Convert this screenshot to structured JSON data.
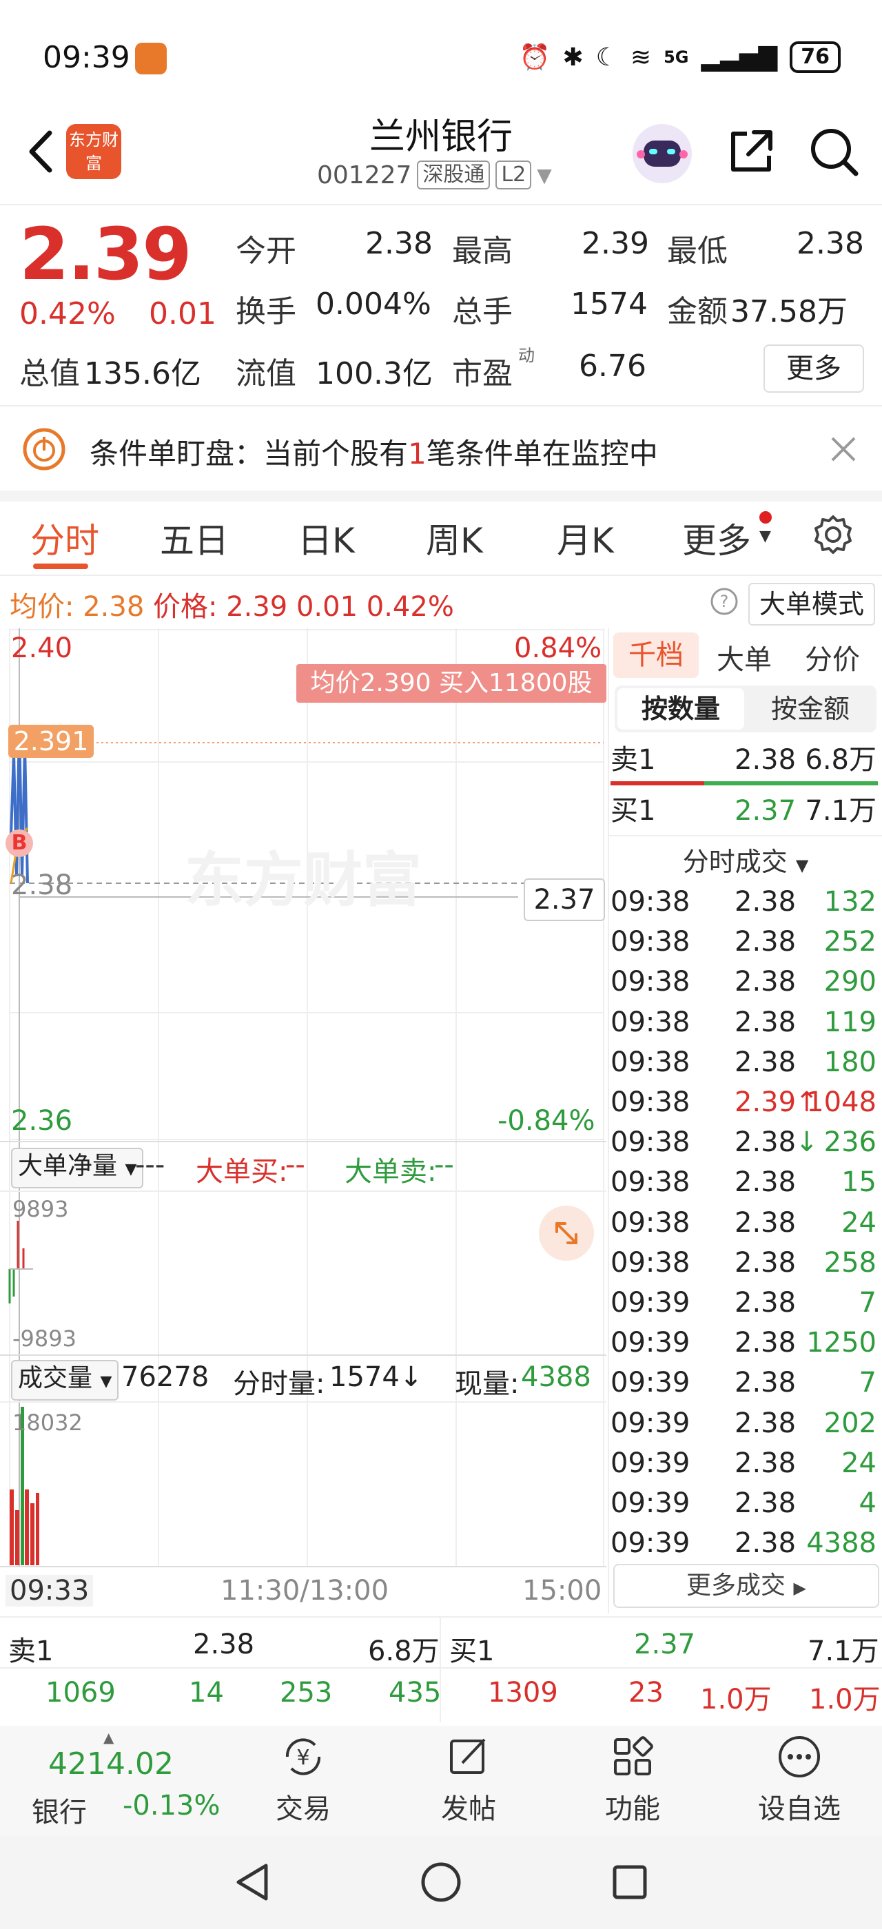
{
  "status_bar": {
    "time": "09:39",
    "network": "5G",
    "battery": "76"
  },
  "header": {
    "logo_text": "东方财富",
    "stock_name": "兰州银行",
    "stock_code": "001227",
    "tag_connect": "深股通",
    "tag_level": "L2"
  },
  "quote": {
    "price": "2.39",
    "pct_change": "0.42%",
    "abs_change": "0.01",
    "open_label": "今开",
    "open": "2.38",
    "high_label": "最高",
    "high": "2.39",
    "low_label": "最低",
    "low": "2.38",
    "turnover_label": "换手",
    "turnover": "0.004%",
    "volume_label": "总手",
    "volume": "1574",
    "amount_label": "金额",
    "amount": "37.58万",
    "mktcap_label": "总值",
    "mktcap": "135.6亿",
    "float_label": "流值",
    "float_cap": "100.3亿",
    "pe_label": "市盈",
    "pe_sup": "动",
    "pe": "6.76",
    "more_label": "更多"
  },
  "condition_banner": {
    "text_pre": "条件单盯盘：当前个股有",
    "count": "1",
    "text_post": "笔条件单在监控中"
  },
  "tabs": [
    "分时",
    "五日",
    "日K",
    "周K",
    "月K",
    "更多"
  ],
  "avg_row": {
    "avg_label": "均价:",
    "avg": "2.38",
    "price_label": "价格:",
    "price": "2.39",
    "change": "0.01",
    "pct": "0.42%",
    "mode_label": "大单模式"
  },
  "chart": {
    "y_top": "2.40",
    "y_top_pct": "0.84%",
    "y_mid": "2.38",
    "y_bottom": "2.36",
    "y_bottom_pct": "-0.84%",
    "price_tag": "2.391",
    "trade_bubble": "均价2.390  买入11800股",
    "cross_price": "2.37",
    "b_marker": "B",
    "watermark": "东方财富",
    "net_selector": "大单净量",
    "net_dashes": "---",
    "big_buy_label": "大单买:",
    "big_buy": "--",
    "big_sell_label": "大单卖:",
    "big_sell": "--",
    "net_max": "9893",
    "net_min": "-9893",
    "vol_selector": "成交量",
    "vol_total": "76278",
    "vol_minute_label": "分时量:",
    "vol_minute": "1574↓",
    "vol_current_label": "现量:",
    "vol_current": "4388",
    "vol_max": "18032",
    "time_start": "09:33",
    "time_mid": "11:30/13:00",
    "time_end": "15:00"
  },
  "right_panel": {
    "tabs": [
      "千档",
      "大单",
      "分价"
    ],
    "seg_qty": "按数量",
    "seg_amt": "按金额",
    "sell1": {
      "label": "卖1",
      "price": "2.38",
      "qty": "6.8万"
    },
    "buy1": {
      "label": "买1",
      "price": "2.37",
      "qty": "7.1万"
    },
    "ticks_title": "分时成交",
    "ticks": [
      {
        "time": "09:38",
        "price": "2.38",
        "vol": "132",
        "dir": ""
      },
      {
        "time": "09:38",
        "price": "2.38",
        "vol": "252",
        "dir": ""
      },
      {
        "time": "09:38",
        "price": "2.38",
        "vol": "290",
        "dir": ""
      },
      {
        "time": "09:38",
        "price": "2.38",
        "vol": "119",
        "dir": ""
      },
      {
        "time": "09:38",
        "price": "2.38",
        "vol": "180",
        "dir": ""
      },
      {
        "time": "09:38",
        "price": "2.39",
        "vol": "1048",
        "dir": "↑"
      },
      {
        "time": "09:38",
        "price": "2.38",
        "vol": "236",
        "dir": "↓"
      },
      {
        "time": "09:38",
        "price": "2.38",
        "vol": "15",
        "dir": ""
      },
      {
        "time": "09:38",
        "price": "2.38",
        "vol": "24",
        "dir": ""
      },
      {
        "time": "09:38",
        "price": "2.38",
        "vol": "258",
        "dir": ""
      },
      {
        "time": "09:39",
        "price": "2.38",
        "vol": "7",
        "dir": ""
      },
      {
        "time": "09:39",
        "price": "2.38",
        "vol": "1250",
        "dir": ""
      },
      {
        "time": "09:39",
        "price": "2.38",
        "vol": "7",
        "dir": ""
      },
      {
        "time": "09:39",
        "price": "2.38",
        "vol": "202",
        "dir": ""
      },
      {
        "time": "09:39",
        "price": "2.38",
        "vol": "24",
        "dir": ""
      },
      {
        "time": "09:39",
        "price": "2.38",
        "vol": "4",
        "dir": ""
      },
      {
        "time": "09:39",
        "price": "2.38",
        "vol": "4388",
        "dir": ""
      }
    ],
    "more_trades": "更多成交"
  },
  "bottom_book": {
    "sell1_label": "卖1",
    "sell1_price": "2.38",
    "sell1_qty": "6.8万",
    "buy1_label": "买1",
    "buy1_price": "2.37",
    "buy1_qty": "7.1万",
    "left_nums": [
      "1069",
      "14",
      "253",
      "435"
    ],
    "right_nums": [
      "1309",
      "23",
      "1.0万",
      "1.0万"
    ]
  },
  "bottom_nav": {
    "index_value": "4214.02",
    "index_name": "银行",
    "index_pct": "-0.13%",
    "trade": "交易",
    "post": "发帖",
    "function": "功能",
    "watchlist": "设自选"
  },
  "colors": {
    "up": "#d9302c",
    "down": "#2e9b3d",
    "accent": "#e8542c",
    "avg_line": "#e8a020",
    "price_line": "#3d6fc8"
  }
}
